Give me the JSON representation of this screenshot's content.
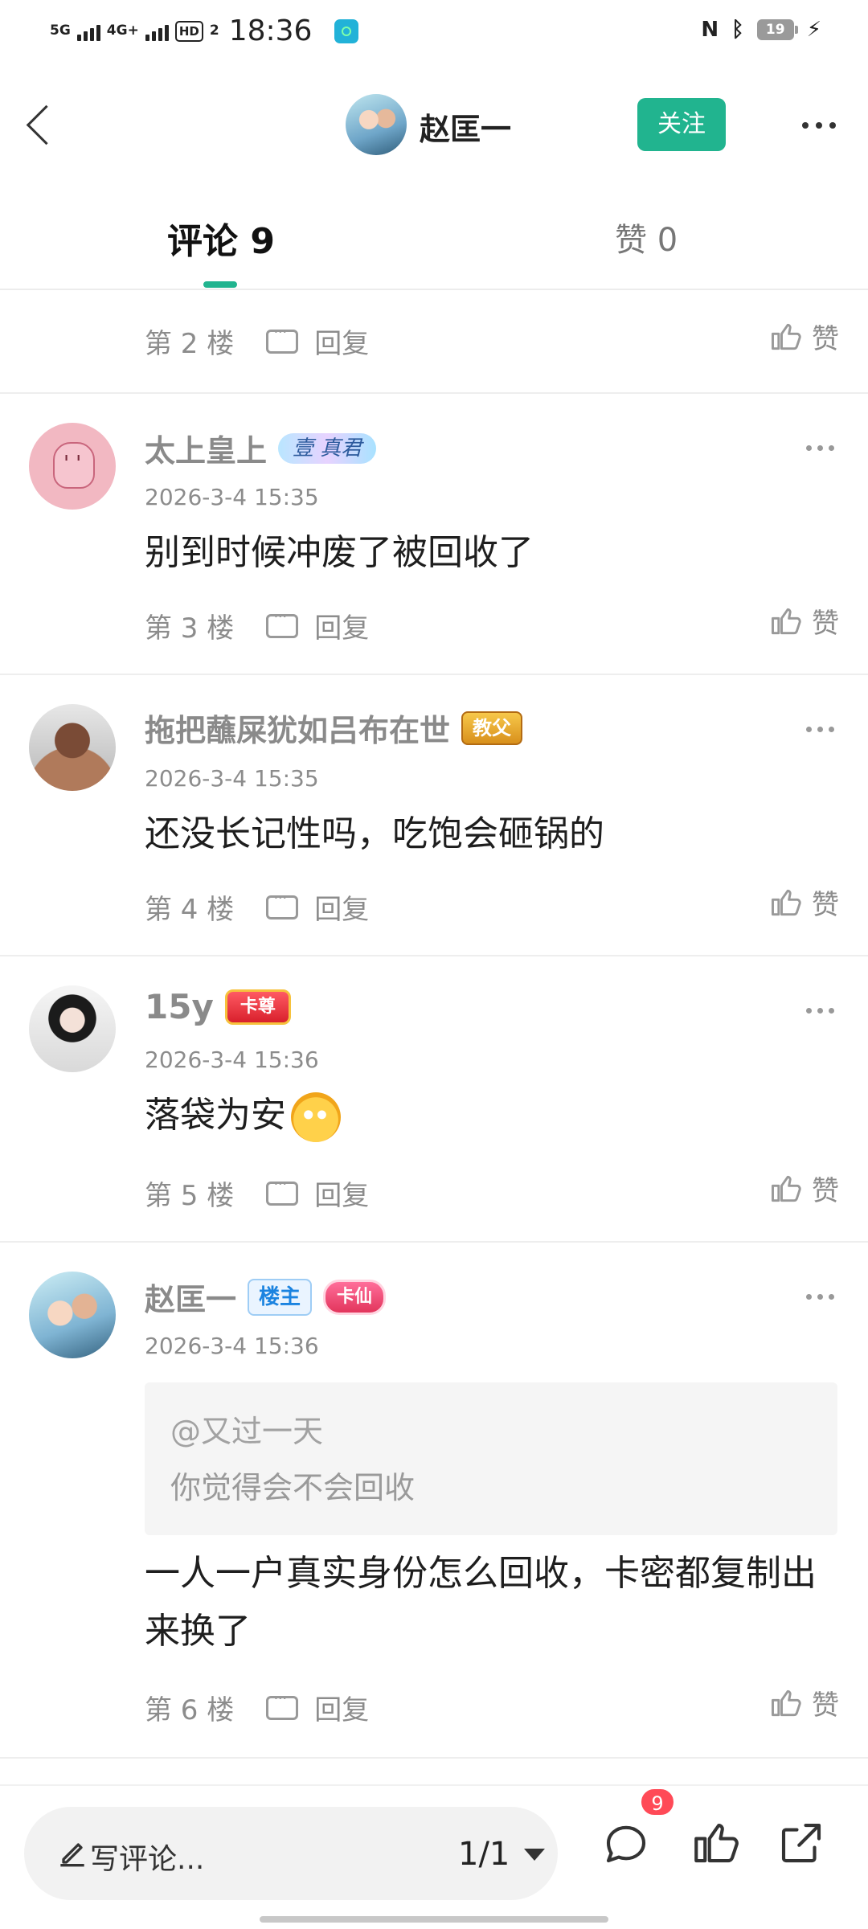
{
  "status_bar": {
    "network1": "5G",
    "network2": "4G+",
    "hd": "HD",
    "hd_sub": "2",
    "time": "18:36",
    "battery": "19"
  },
  "header": {
    "author_name": "赵匡一",
    "follow_label": "关注"
  },
  "tabs": {
    "comments": "评论 9",
    "likes": "赞 0"
  },
  "top_partial": {
    "floor": "第 2 楼",
    "reply": "回复",
    "like": "赞"
  },
  "comments": [
    {
      "user": "太上皇上",
      "badges": [
        "壹 真君"
      ],
      "time": "2026-3-4 15:35",
      "text": "别到时候冲废了被回收了",
      "floor": "第 3 楼",
      "reply": "回复",
      "like": "赞"
    },
    {
      "user": "拖把蘸屎犹如吕布在世",
      "badges": [
        "教父"
      ],
      "time": "2026-3-4 15:35",
      "text": "还没长记性吗，吃饱会砸锅的",
      "floor": "第 4 楼",
      "reply": "回复",
      "like": "赞"
    },
    {
      "user": "15y",
      "badges": [
        "卡尊"
      ],
      "time": "2026-3-4 15:36",
      "text": "落袋为安",
      "floor": "第 5 楼",
      "reply": "回复",
      "like": "赞"
    },
    {
      "user": "赵匡一",
      "badges": [
        "楼主",
        "卡仙"
      ],
      "time": "2026-3-4 15:36",
      "quote_user": "@又过一天",
      "quote_text": "你觉得会不会回收",
      "text": "一人一户真实身份怎么回收，卡密都复制出来换了",
      "floor": "第 6 楼",
      "reply": "回复",
      "like": "赞"
    }
  ],
  "bottom_bar": {
    "placeholder": "写评论...",
    "page_indicator": "1/1",
    "comment_count": "9"
  },
  "colors": {
    "accent": "#21b48f",
    "badge_red": "#ff4a57"
  }
}
